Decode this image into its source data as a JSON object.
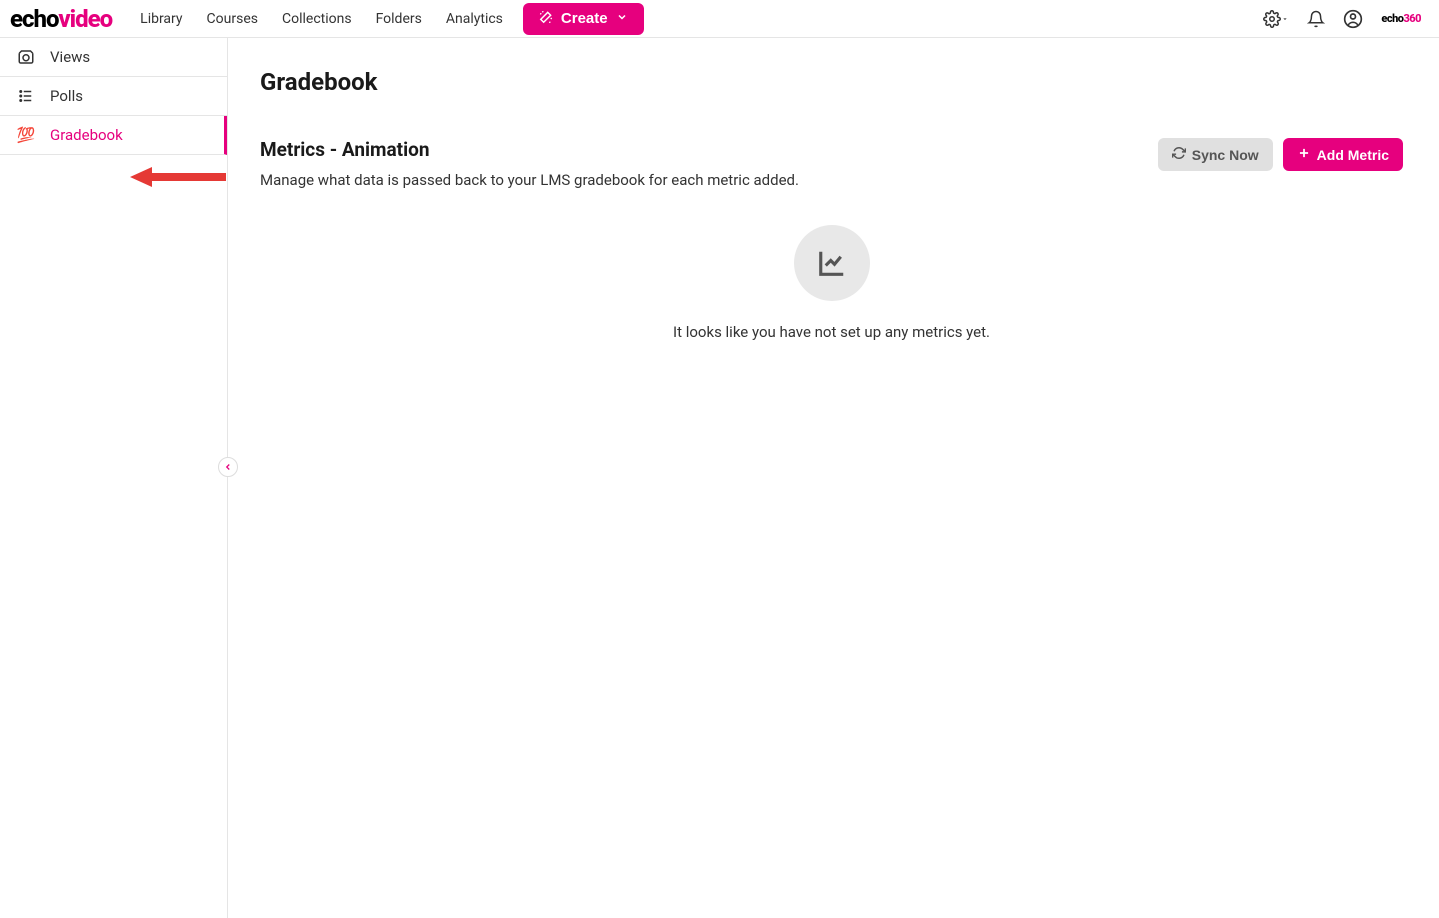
{
  "header": {
    "logo_part1": "echo",
    "logo_part2": "video",
    "nav": [
      "Library",
      "Courses",
      "Collections",
      "Folders",
      "Analytics"
    ],
    "create_label": "Create",
    "small_logo_part1": "echo",
    "small_logo_part2": "360"
  },
  "sidebar": {
    "items": [
      {
        "label": "Views"
      },
      {
        "label": "Polls"
      },
      {
        "label": "Gradebook"
      }
    ]
  },
  "main": {
    "page_title": "Gradebook",
    "metrics_heading": "Metrics - Animation",
    "metrics_desc": "Manage what data is passed back to your LMS gradebook for each metric added.",
    "sync_label": "Sync Now",
    "add_label": "Add Metric",
    "empty_text": "It looks like you have not set up any metrics yet."
  }
}
